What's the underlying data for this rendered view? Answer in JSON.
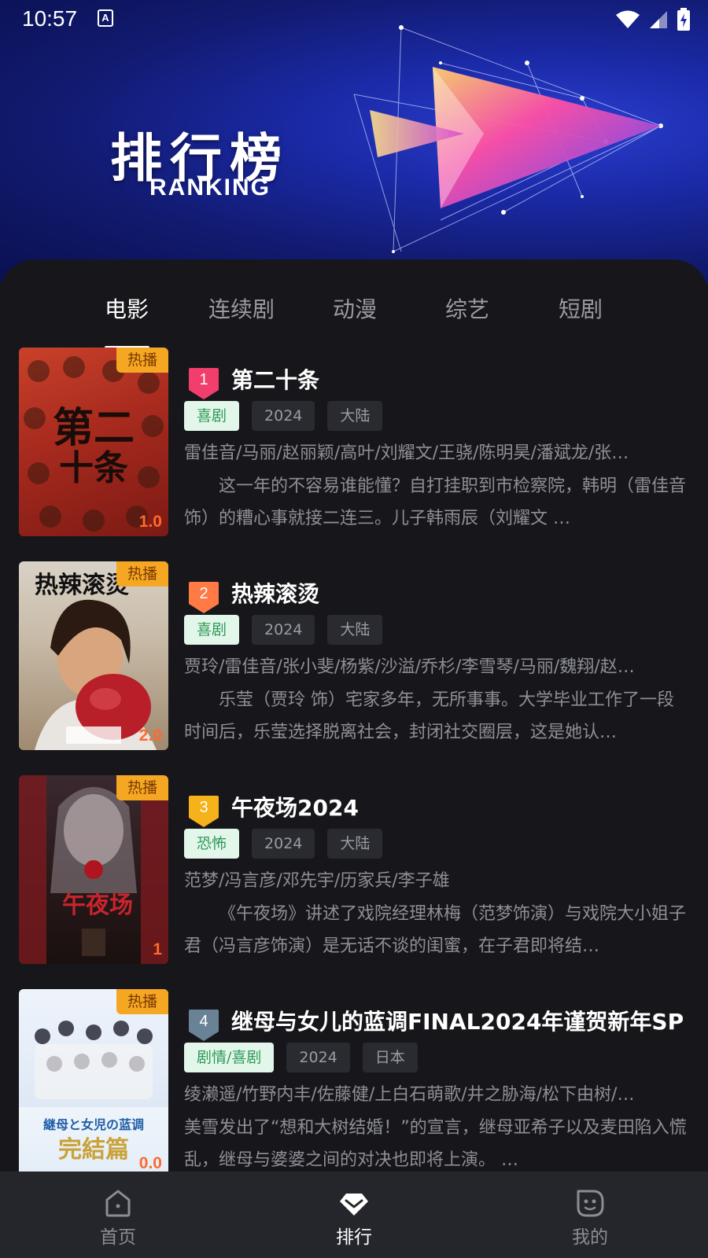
{
  "status": {
    "time": "10:57"
  },
  "header": {
    "title_cn": "排行榜",
    "title_en": "RANKING"
  },
  "tabs": [
    {
      "label": "电影",
      "active": true
    },
    {
      "label": "连续剧"
    },
    {
      "label": "动漫"
    },
    {
      "label": "综艺"
    },
    {
      "label": "短剧"
    }
  ],
  "items": [
    {
      "rank": "1",
      "badge": "热播",
      "score": "1.0",
      "title": "第二十条",
      "genre": "喜剧",
      "year": "2024",
      "region": "大陆",
      "cast": "雷佳音/马丽/赵丽颖/高叶/刘耀文/王骁/陈明昊/潘斌龙/张…",
      "desc": "这一年的不容易谁能懂？自打挂职到市检察院，韩明（雷佳音 饰）的糟心事就接二连三。儿子韩雨辰（刘耀文 …",
      "rank_color": "#f23e6d"
    },
    {
      "rank": "2",
      "badge": "热播",
      "score": "2.0",
      "title": "热辣滚烫",
      "genre": "喜剧",
      "year": "2024",
      "region": "大陆",
      "cast": "贾玲/雷佳音/张小斐/杨紫/沙溢/乔杉/李雪琴/马丽/魏翔/赵…",
      "desc": "乐莹（贾玲 饰）宅家多年，无所事事。大学毕业工作了一段时间后，乐莹选择脱离社会，封闭社交圈层，这是她认…",
      "rank_color": "#ff7a45"
    },
    {
      "rank": "3",
      "badge": "热播",
      "score": "1",
      "title": "午夜场2024",
      "genre": "恐怖",
      "year": "2024",
      "region": "大陆",
      "cast": "范梦/冯言彦/邓先宇/历家兵/李子雄",
      "desc": "《午夜场》讲述了戏院经理林梅（范梦饰演）与戏院大小姐子君（冯言彦饰演）是无话不谈的闺蜜，在子君即将结…",
      "rank_color": "#f6b21b"
    },
    {
      "rank": "4",
      "badge": "热播",
      "score": "0.0",
      "title": "继母与女儿的蓝调FINAL2024年谨贺新年SP",
      "genre": "剧情/喜剧",
      "year": "2024",
      "region": "日本",
      "cast": "绫濑遥/竹野内丰/佐藤健/上白石萌歌/井之胁海/松下由树/…",
      "desc": "美雪发出了“想和大树结婚！”的宣言，继母亚希子以及麦田陷入慌乱，继母与婆婆之间的对决也即将上演。 …",
      "rank_color": "#6a8296"
    }
  ],
  "bottom_nav": [
    {
      "label": "首页",
      "icon": "home-icon"
    },
    {
      "label": "排行",
      "icon": "diamond-icon",
      "active": true
    },
    {
      "label": "我的",
      "icon": "profile-icon"
    }
  ]
}
